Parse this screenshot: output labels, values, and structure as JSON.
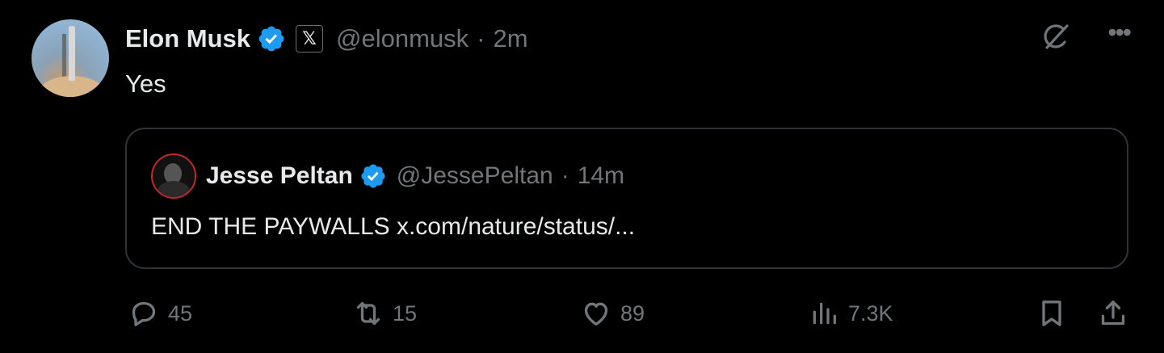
{
  "post": {
    "author_name": "Elon Musk",
    "author_handle": "@elonmusk",
    "separator": "·",
    "time": "2m",
    "text": "Yes",
    "affiliate_badge": "𝕏"
  },
  "quote": {
    "author_name": "Jesse Peltan",
    "author_handle": "@JessePeltan",
    "separator": "·",
    "time": "14m",
    "text": "END THE PAYWALLS x.com/nature/status/..."
  },
  "actions": {
    "replies": "45",
    "reposts": "15",
    "likes": "89",
    "views": "7.3K"
  },
  "icons": [
    "verified-badge-icon",
    "x-affiliate-icon",
    "grok-icon",
    "more-icon",
    "reply-icon",
    "retweet-icon",
    "like-icon",
    "views-icon",
    "bookmark-icon",
    "share-icon"
  ],
  "colors": {
    "background": "#000000",
    "text": "#e7e9ea",
    "secondary": "#71767b",
    "verified": "#1d9bf0",
    "border": "#2f3336"
  }
}
